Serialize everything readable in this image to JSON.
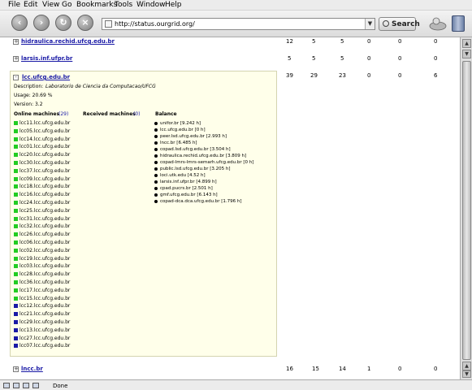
{
  "menu": [
    "File",
    "Edit",
    "View",
    "Go",
    "Bookmarks",
    "Tools",
    "Window",
    "Help"
  ],
  "toolbar": {
    "back_icon": "back-arrow-icon",
    "forward_icon": "forward-arrow-icon",
    "reload_icon": "reload-icon",
    "stop_icon": "stop-icon",
    "url": "http://status.ourgrid.org/",
    "search_label": "Search"
  },
  "sites": [
    {
      "name": "hidraulica.rechid.ufcg.edu.br",
      "toggle": "+",
      "values": [
        "12",
        "5",
        "5",
        "0",
        "0",
        "0"
      ]
    },
    {
      "name": "larsis.inf.ufpr.br",
      "toggle": "+",
      "values": [
        "5",
        "5",
        "5",
        "0",
        "0",
        "0"
      ]
    },
    {
      "name": "lcc.ufcg.edu.br",
      "toggle": "-",
      "values": [
        "39",
        "29",
        "23",
        "0",
        "0",
        "6"
      ]
    },
    {
      "name": "lncc.br",
      "toggle": "+",
      "values": [
        "16",
        "15",
        "14",
        "1",
        "0",
        "0"
      ]
    }
  ],
  "details": {
    "description_label": "Description:",
    "description_value": "Laboratorio de Ciencia da Computacao/UFCG",
    "usage": "Usage: 20.69 %",
    "version": "Version: 3.2",
    "online_header": "Online machines",
    "online_count": "(29)",
    "received_header": "Received machines",
    "received_count": "(0)",
    "balance_header": "Balance",
    "online_machines": [
      "lcc11.lcc.ufcg.edu.br",
      "lcc05.lcc.ufcg.edu.br",
      "lcc14.lcc.ufcg.edu.br",
      "lcc01.lcc.ufcg.edu.br",
      "lcc20.lcc.ufcg.edu.br",
      "lcc30.lcc.ufcg.edu.br",
      "lcc37.lcc.ufcg.edu.br",
      "lcc09.lcc.ufcg.edu.br",
      "lcc18.lcc.ufcg.edu.br",
      "lcc16.lcc.ufcg.edu.br",
      "lcc24.lcc.ufcg.edu.br",
      "lcc25.lcc.ufcg.edu.br",
      "lcc31.lcc.ufcg.edu.br",
      "lcc32.lcc.ufcg.edu.br",
      "lcc26.lcc.ufcg.edu.br",
      "lcc06.lcc.ufcg.edu.br",
      "lcc02.lcc.ufcg.edu.br",
      "lcc19.lcc.ufcg.edu.br",
      "lcc03.lcc.ufcg.edu.br",
      "lcc28.lcc.ufcg.edu.br",
      "lcc36.lcc.ufcg.edu.br",
      "lcc17.lcc.ufcg.edu.br",
      "lcc15.lcc.ufcg.edu.br"
    ],
    "offline_machines": [
      "lcc12.lcc.ufcg.edu.br",
      "lcc21.lcc.ufcg.edu.br",
      "lcc29.lcc.ufcg.edu.br",
      "lcc13.lcc.ufcg.edu.br",
      "lcc27.lcc.ufcg.edu.br",
      "lcc07.lcc.ufcg.edu.br"
    ],
    "balance": [
      "unifor.br [9.242 h]",
      "lcc.ufcg.edu.br [0 h]",
      "peer.lsd.ufcg.edu.br [2.993 h]",
      "lncc.br [6.485 h]",
      "copad.lsd.ufcg.edu.br [3.504 h]",
      "hidraulica.rechid.ufcg.edu.br [3.809 h]",
      "copad-lmrs-lmrs-semarh.ufcg.edu.br [0 h]",
      "public.lsd.ufcg.edu.br [3.205 h]",
      "loci.utk.edu [4.52 h]",
      "larsis.inf.ufpr.br [4.899 h]",
      "cpad.pucrs.br [2.501 h]",
      "gmf.ufcg.edu.br [6.143 h]",
      "copad-dca.dca.ufcg.edu.br [1.796 h]"
    ]
  },
  "status": {
    "text": "Done"
  },
  "colors": {
    "online": "#22cc22",
    "offline": "#1a1aa6",
    "panel": "#ffffea",
    "link": "#1a1aa6"
  }
}
